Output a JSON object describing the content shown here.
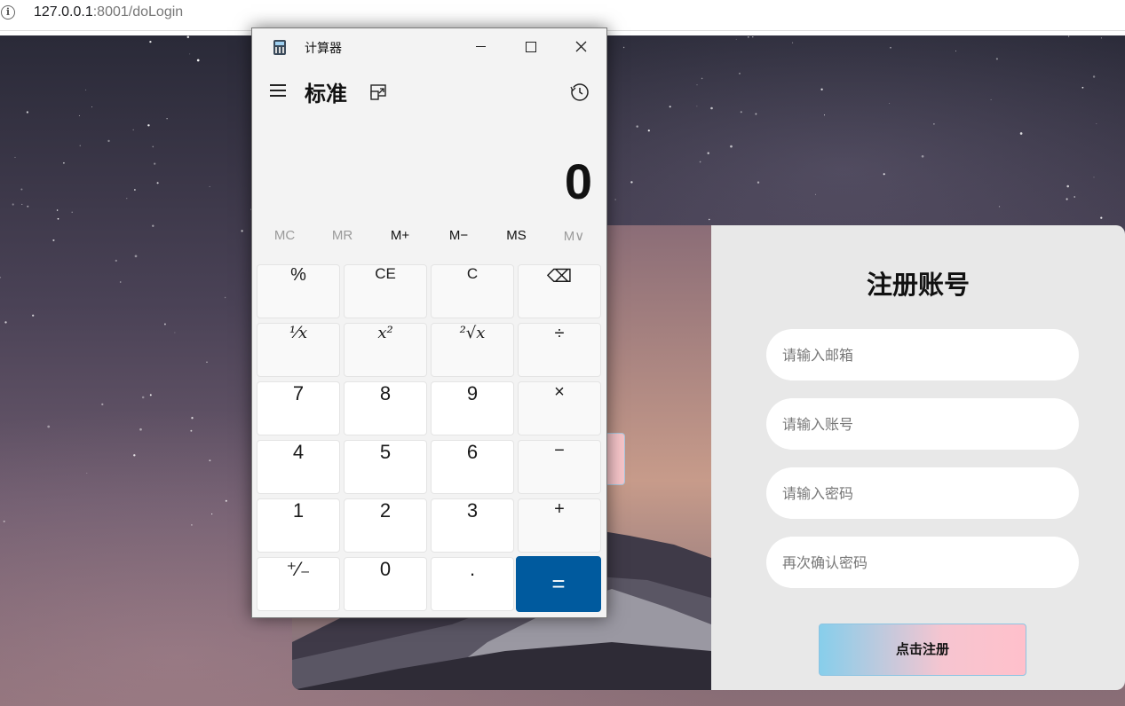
{
  "browser": {
    "url_host": "127.0.0.1",
    "url_rest": ":8001/doLogin"
  },
  "calculator": {
    "title": "计算器",
    "mode": "标准",
    "display": "0",
    "memory": [
      "MC",
      "MR",
      "M+",
      "M−",
      "MS",
      "M∨"
    ],
    "keys": [
      [
        "%",
        "CE",
        "C",
        "⌫"
      ],
      [
        "¹⁄x",
        "x²",
        "²√x",
        "÷"
      ],
      [
        "7",
        "8",
        "9",
        "×"
      ],
      [
        "4",
        "5",
        "6",
        "−"
      ],
      [
        "1",
        "2",
        "3",
        "+"
      ],
      [
        "⁺⁄₋",
        "0",
        ".",
        "="
      ]
    ]
  },
  "register": {
    "title": "注册账号",
    "email_placeholder": "请输入邮箱",
    "account_placeholder": "请输入账号",
    "password_placeholder": "请输入密码",
    "confirm_placeholder": "再次确认密码",
    "submit_label": "点击注册"
  },
  "colors": {
    "equals_key": "#005a9e",
    "panel_bg": "#e8e8e8",
    "submit_gradient_start": "#87ceeb",
    "submit_gradient_end": "#ffc0cb"
  }
}
